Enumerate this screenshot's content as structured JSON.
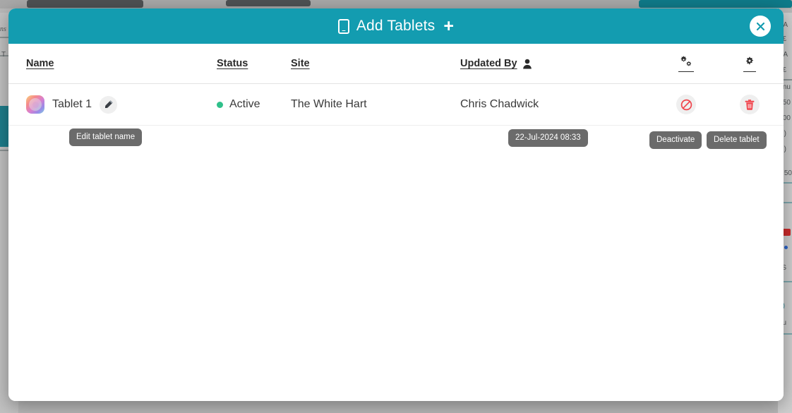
{
  "modal": {
    "title": "Add Tablets",
    "title_plus": "+",
    "tablet_icon": "tablet-icon",
    "close_icon": "close-icon",
    "accent_color": "#139cb0"
  },
  "table": {
    "columns": [
      {
        "label": "Name",
        "icon": null
      },
      {
        "label": "Status",
        "icon": null
      },
      {
        "label": "Site",
        "icon": null
      },
      {
        "label": "Updated By",
        "icon": "person-icon"
      },
      {
        "label": "",
        "icon": "gears-icon"
      },
      {
        "label": "",
        "icon": "gear-icon"
      }
    ],
    "rows": [
      {
        "name": "Tablet 1",
        "status": "Active",
        "status_color": "#2fc08a",
        "site": "The White Hart",
        "updated_by": "Chris Chadwick",
        "edit_icon": "pencil-icon",
        "deactivate_icon": "ban-icon",
        "delete_icon": "trash-icon",
        "action_color": "#f0444c"
      }
    ]
  },
  "tooltips": {
    "edit_name": "Edit tablet name",
    "updated_timestamp": "22-Jul-2024 08:33",
    "deactivate": "Deactivate",
    "delete": "Delete tablet"
  },
  "background": {
    "text_left_1": "ns",
    "text_left_2": "T",
    "text_right_1": "A",
    "text_right_2": "£",
    "text_right_3": "A",
    "text_right_4": "£",
    "text_right_5": "nu",
    "text_right_6": "50",
    "text_right_7": "00",
    "text_right_8": ")",
    "text_right_9": ")",
    "text_right_10": "50",
    "text_right_11": "S",
    "text_right_12": ")",
    "text_right_13": "u"
  }
}
